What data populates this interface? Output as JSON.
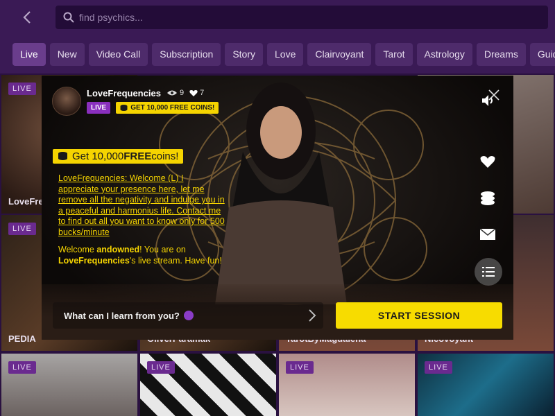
{
  "search": {
    "placeholder": "find psychics..."
  },
  "tabs": [
    "Live",
    "New",
    "Video Call",
    "Subscription",
    "Story",
    "Love",
    "Clairvoyant",
    "Tarot",
    "Astrology",
    "Dreams",
    "Guides"
  ],
  "grid": {
    "live_label": "LIVE",
    "cards": [
      {
        "name": "LoveFre"
      },
      {
        "name": ""
      },
      {
        "name": ""
      },
      {
        "name": "PEDIA"
      },
      {
        "name": ""
      },
      {
        "name": ""
      },
      {
        "name": ""
      },
      {
        "name": ""
      },
      {
        "name": "OliverParamak"
      },
      {
        "name": "TarotByMagdalena"
      },
      {
        "name": "Nicovoyant"
      }
    ]
  },
  "modal": {
    "host_name": "LoveFrequencies",
    "viewers": "9",
    "likes": "7",
    "live_badge": "LIVE",
    "coins_badge": "GET 10,000 FREE COINS!",
    "promo_pre": "Get 10,000 ",
    "promo_bold": "FREE",
    "promo_post": " coins!",
    "chat": {
      "message1": "LoveFrequencies: Welcome (L) I appreciate your presence here, let me remove all the negativity and indulge you in a peaceful and harmonius life. Contact me to find out all you want to know only for 500 bucks/minute",
      "welcome_pre": "Welcome ",
      "welcome_user": "andowned",
      "welcome_mid": "! You are on ",
      "welcome_host": "LoveFrequencies",
      "welcome_post": "'s live stream. Have fun!"
    },
    "ask_placeholder": "What can I learn from you?",
    "start_label": "START SESSION"
  },
  "colors": {
    "accent": "#f5d400",
    "live": "#8a2fbe",
    "bg": "#2a1140"
  }
}
